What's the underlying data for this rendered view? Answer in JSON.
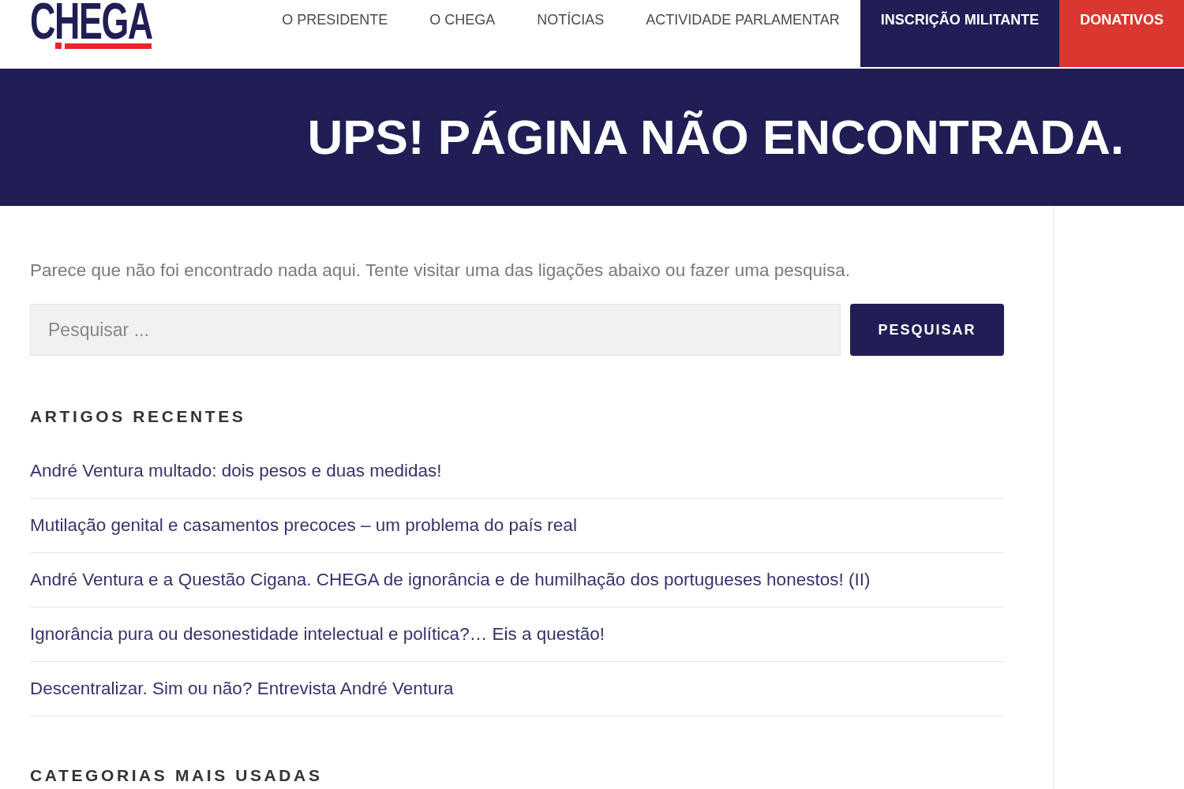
{
  "header": {
    "logo": "CHEGA",
    "nav": [
      {
        "label": "O PRESIDENTE",
        "kind": "link"
      },
      {
        "label": "O CHEGA",
        "kind": "link"
      },
      {
        "label": "NOTÍCIAS",
        "kind": "link"
      },
      {
        "label": "ACTIVIDADE PARLAMENTAR",
        "kind": "link"
      },
      {
        "label": "INSCRIÇÃO MILITANTE",
        "kind": "button",
        "color": "#201e55"
      },
      {
        "label": "DONATIVOS",
        "kind": "button",
        "color": "#d9372f"
      }
    ]
  },
  "banner": {
    "title": "UPS! PÁGINA NÃO ENCONTRADA."
  },
  "content": {
    "message": "Parece que não foi encontrado nada aqui. Tente visitar uma das ligações abaixo ou fazer uma pesquisa.",
    "search": {
      "placeholder": "Pesquisar ...",
      "button": "PESQUISAR"
    },
    "recent_posts": {
      "title": "ARTIGOS RECENTES",
      "items": [
        "André Ventura multado: dois pesos e duas medidas!",
        "Mutilação genital e casamentos precoces – um problema do país real",
        "André Ventura e a Questão Cigana. CHEGA de ignorância e de humilhação dos portugueses honestos! (II)",
        "Ignorância pura ou desonestidade intelectual e política?… Eis a questão!",
        "Descentralizar. Sim ou não? Entrevista André Ventura"
      ]
    },
    "categories": {
      "title": "CATEGORIAS MAIS USADAS"
    }
  }
}
